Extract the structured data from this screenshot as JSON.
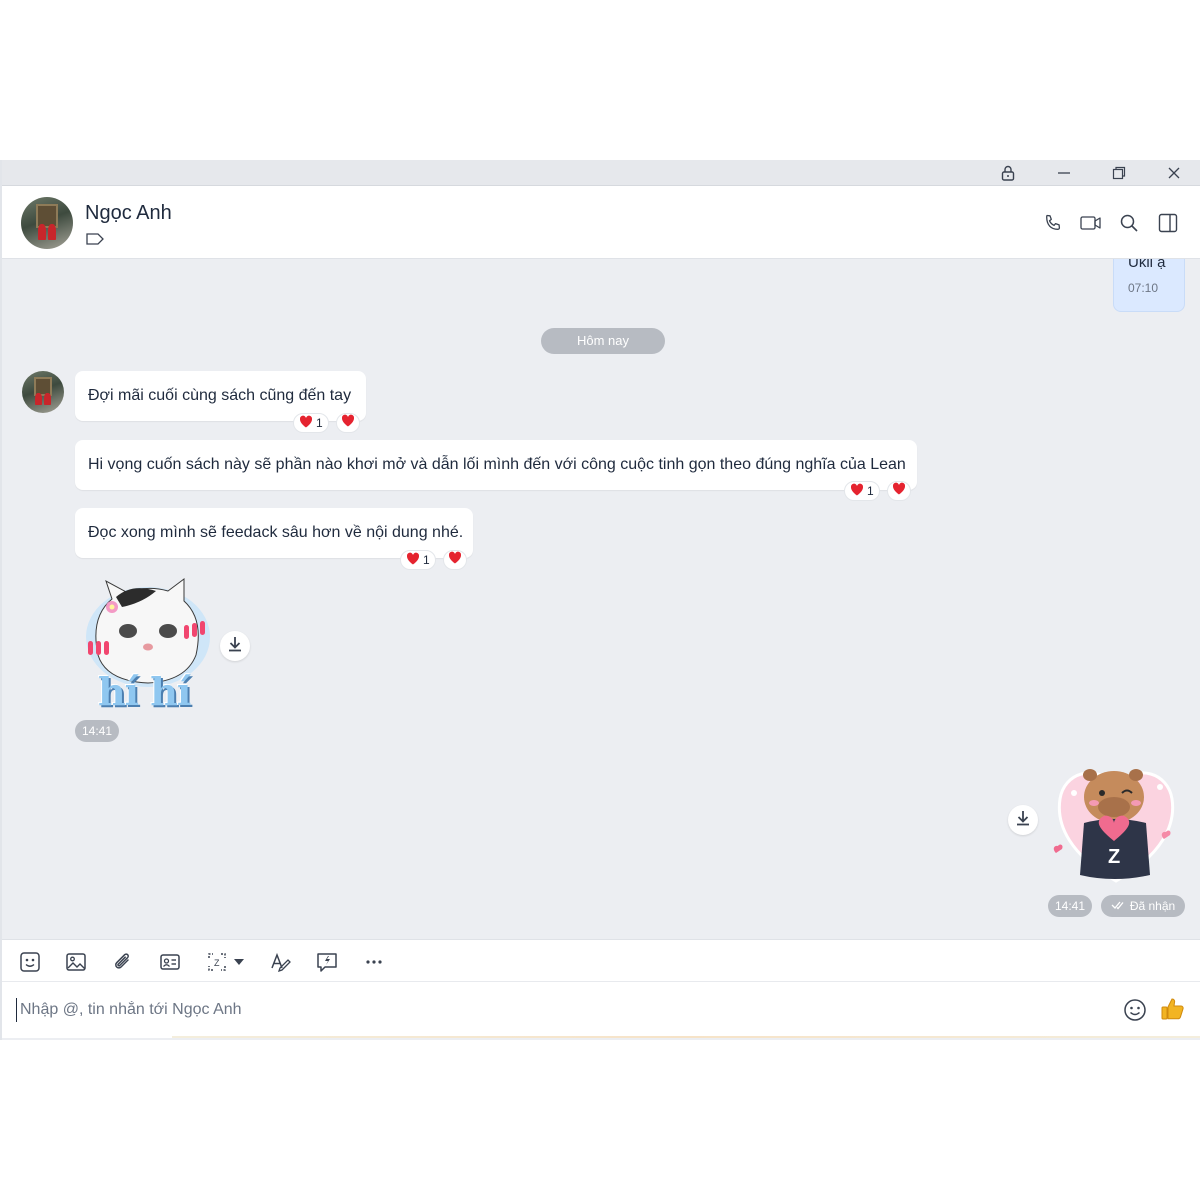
{
  "header": {
    "contact_name": "Ngọc Anh"
  },
  "chat": {
    "previous_my_message": {
      "text": "Ukii ạ",
      "time": "07:10"
    },
    "date_divider": "Hôm nay",
    "incoming_messages": [
      {
        "text": "Đợi mãi cuối cùng sách cũng đến tay",
        "reaction_count": "1"
      },
      {
        "text": "Hi vọng cuốn sách này sẽ phần nào khơi mở và dẫn lối mình đến với công cuộc tinh gọn theo đúng nghĩa của Lean",
        "reaction_count": "1"
      },
      {
        "text": "Đọc xong mình sẽ feedack sâu hơn về nội dung nhé.",
        "reaction_count": "1"
      }
    ],
    "incoming_sticker": {
      "caption": "hí hí",
      "time": "14:41"
    },
    "outgoing_sticker": {
      "time": "14:41",
      "status": "Đã nhận"
    }
  },
  "composer": {
    "placeholder": "Nhập @, tin nhắn tới Ngọc Anh"
  },
  "colors": {
    "chat_background": "#eceef2",
    "my_bubble": "#dbe9ff",
    "heart": "#e5232f",
    "thumb": "#f2b422"
  },
  "icons": {
    "titlebar": [
      "lock-icon",
      "minimize-icon",
      "restore-icon",
      "close-icon"
    ],
    "header": [
      "phone-icon",
      "video-call-icon",
      "search-icon",
      "sidebar-toggle-icon"
    ],
    "toolbar": [
      "sticker-icon",
      "image-icon",
      "attachment-icon",
      "contact-card-icon",
      "screenshot-icon",
      "dropdown-caret-icon",
      "text-format-icon",
      "quick-message-icon",
      "more-icon"
    ],
    "composer": [
      "emoji-icon",
      "thumbs-up-icon"
    ]
  }
}
